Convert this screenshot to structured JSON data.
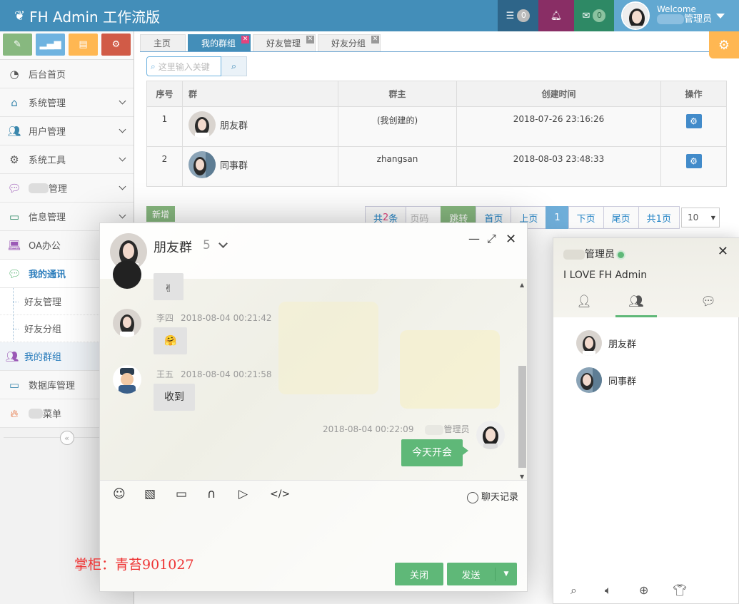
{
  "brand": {
    "title": "FH Admin 工作流版"
  },
  "navbar": {
    "tasks_count": "0",
    "mail_count": "0",
    "welcome": "Welcome",
    "user_suffix": "管理员"
  },
  "sidebar": {
    "items": [
      {
        "label": "后台首页",
        "icon": "dashboard-icon"
      },
      {
        "label": "系统管理",
        "icon": "home-icon"
      },
      {
        "label": "用户管理",
        "icon": "users-icon"
      },
      {
        "label": "系统工具",
        "icon": "cog-icon"
      },
      {
        "label": "管理",
        "icon": "chat-icon"
      },
      {
        "label": "信息管理",
        "icon": "card-icon"
      },
      {
        "label": "OA办公",
        "icon": "laptop-icon"
      },
      {
        "label": "我的通讯",
        "icon": "comments-icon"
      },
      {
        "label": "好友管理"
      },
      {
        "label": "好友分组"
      },
      {
        "label": "我的群组",
        "icon": "group-icon"
      },
      {
        "label": "数据库管理",
        "icon": "hdd-icon"
      },
      {
        "label": "菜单",
        "icon": "fire-icon"
      }
    ]
  },
  "tabs": [
    {
      "label": "主页"
    },
    {
      "label": "我的群组"
    },
    {
      "label": "好友管理"
    },
    {
      "label": "好友分组"
    }
  ],
  "search": {
    "placeholder": "这里输入关键"
  },
  "table": {
    "headers": [
      "序号",
      "群",
      "群主",
      "创建时间",
      "操作"
    ],
    "rows": [
      {
        "no": "1",
        "group": "朋友群",
        "owner": "(我创建的)",
        "created": "2018-07-26 23:16:26"
      },
      {
        "no": "2",
        "group": "同事群",
        "owner": "zhangsan",
        "created": "2018-08-03 23:48:33"
      }
    ]
  },
  "add_button": "新增",
  "pager": {
    "total_prefix": "共",
    "total_count": "2",
    "total_suffix": "条",
    "page_input_placeholder": "页码",
    "jump": "跳转",
    "first": "首页",
    "prev": "上页",
    "current": "1",
    "next": "下页",
    "last": "尾页",
    "pages": "共1页",
    "page_size": "10"
  },
  "chat": {
    "title": "朋友群",
    "member_count": "5",
    "messages": [
      {
        "sender": "",
        "time": "",
        "content": "✌"
      },
      {
        "sender": "李四",
        "time": "2018-08-04 00:21:42",
        "content": "🤗"
      },
      {
        "sender": "王五",
        "time": "2018-08-04 00:21:58",
        "content": "收到"
      },
      {
        "sender": "管理员",
        "time": "2018-08-04 00:22:09",
        "content": "今天开会"
      }
    ],
    "history": "聊天记录",
    "close": "关闭",
    "send": "发送",
    "watermark": "掌柜：青苔901027"
  },
  "panel": {
    "user": "管理员",
    "sign": "I LOVE FH Admin",
    "groups": [
      {
        "name": "朋友群"
      },
      {
        "name": "同事群"
      }
    ]
  },
  "colors": {
    "navbar": "#438eb9",
    "accent_green": "#5fb878",
    "active_tab": "#438eb9"
  }
}
